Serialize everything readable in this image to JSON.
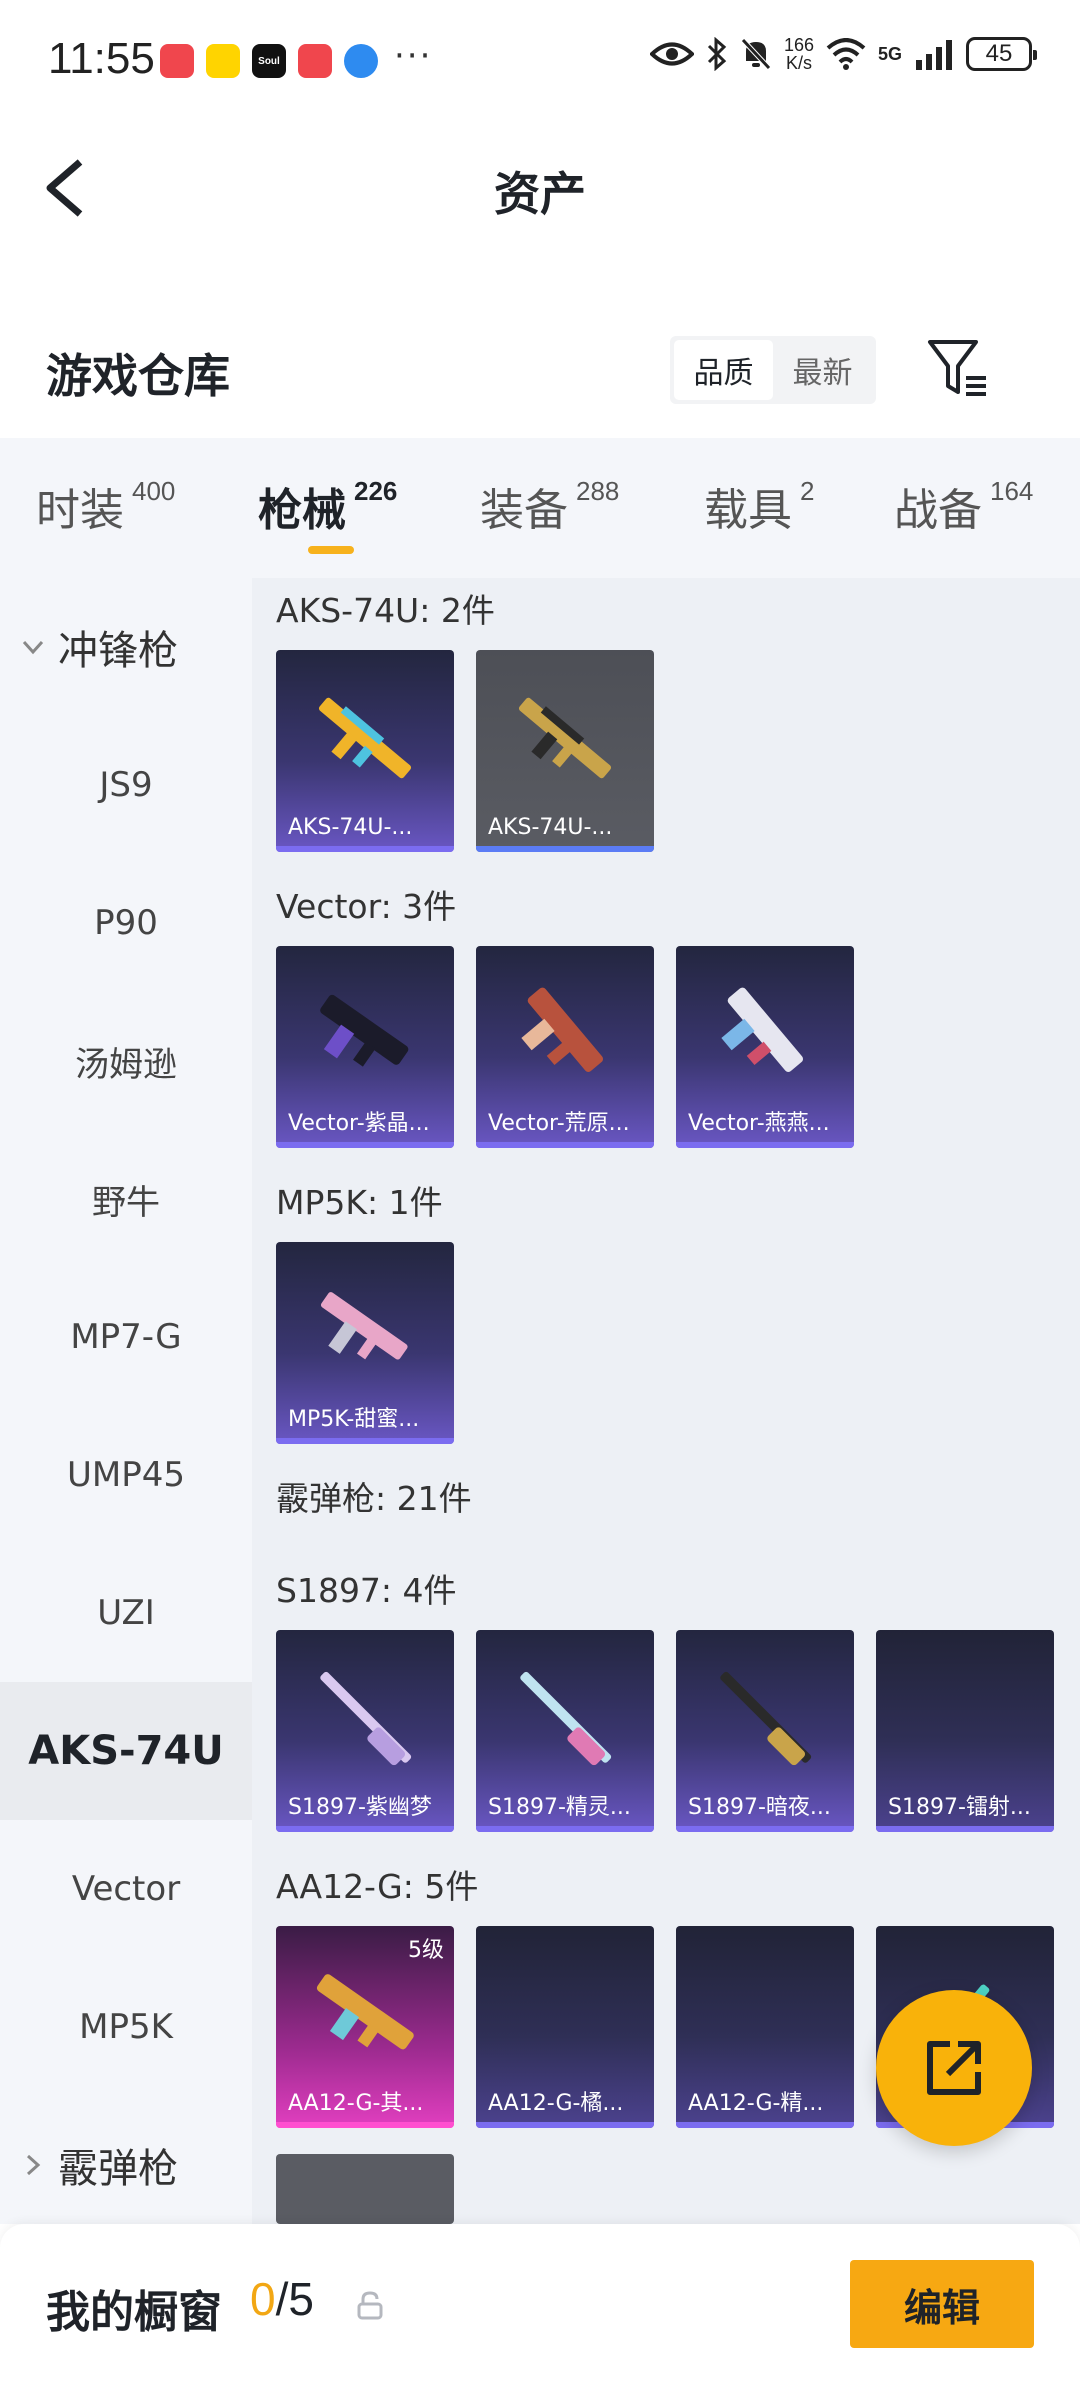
{
  "status_bar": {
    "time": "11:55",
    "net_speed_top": "166",
    "net_speed_bottom": "K/s",
    "signal_label": "5G",
    "battery": "45",
    "apps": [
      "notif-app-1",
      "notif-app-2",
      "Soul",
      "notif-app-4",
      "notif-app-5"
    ],
    "more": "···"
  },
  "header": {
    "title": "资产"
  },
  "warehouse": {
    "title": "游戏仓库",
    "sort_options": [
      "品质",
      "最新"
    ],
    "sort_selected": "品质"
  },
  "tabs": [
    {
      "label": "时装",
      "count": "400"
    },
    {
      "label": "枪械",
      "count": "226",
      "active": true
    },
    {
      "label": "装备",
      "count": "288"
    },
    {
      "label": "载具",
      "count": "2"
    },
    {
      "label": "战备",
      "count": "164"
    }
  ],
  "sidebar": {
    "group_smg": "冲锋枪",
    "items": [
      "JS9",
      "P90",
      "汤姆逊",
      "野牛",
      "MP7-G",
      "UMP45",
      "UZI",
      "AKS-74U",
      "Vector",
      "MP5K"
    ],
    "active_item": "AKS-74U",
    "group_shotgun": "霰弹枪"
  },
  "groups": {
    "aks": {
      "label": "AKS-74U: 2件",
      "cards": [
        "AKS-74U-...",
        "AKS-74U-..."
      ]
    },
    "vector": {
      "label": "Vector: 3件",
      "cards": [
        "Vector-紫晶...",
        "Vector-荒原...",
        "Vector-燕燕..."
      ]
    },
    "mp5k": {
      "label": "MP5K: 1件",
      "cards": [
        "MP5K-甜蜜..."
      ]
    },
    "shotgun": {
      "label": "霰弹枪: 21件"
    },
    "s1897": {
      "label": "S1897: 4件",
      "cards": [
        "S1897-紫幽梦",
        "S1897-精灵...",
        "S1897-暗夜...",
        "S1897-镭射..."
      ]
    },
    "aa12": {
      "label": "AA12-G: 5件",
      "cards": [
        "AA12-G-其...",
        "AA12-G-橘...",
        "AA12-G-精...",
        "..."
      ],
      "level_badge": "5级"
    }
  },
  "colors": {
    "accent": "#f7b21c",
    "fab": "#f9b20a",
    "count_highlight": "#f2a714"
  },
  "bottom": {
    "title": "我的橱窗",
    "count_current": "0",
    "count_sep": "/5",
    "edit_label": "编辑"
  }
}
